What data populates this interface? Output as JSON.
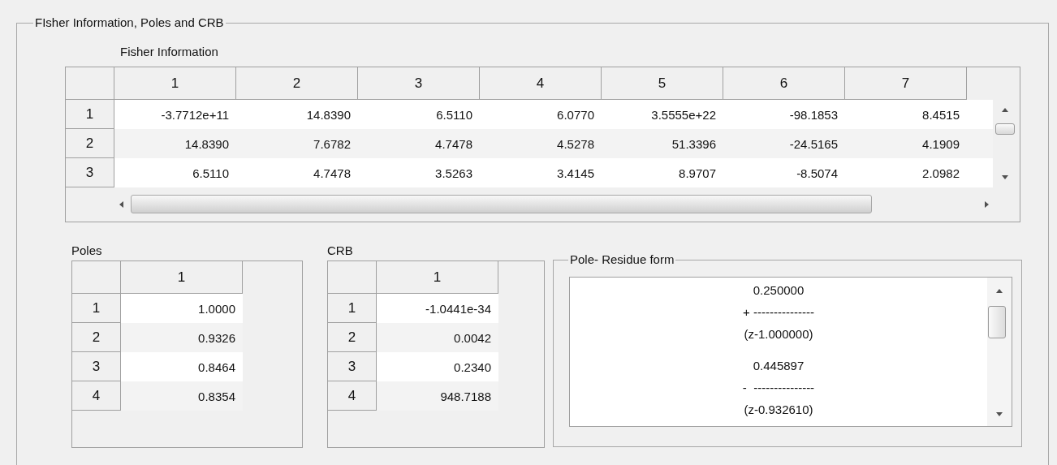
{
  "panel": {
    "title": "FIsher Information, Poles and  CRB"
  },
  "fisher": {
    "label": "Fisher Information",
    "columns": [
      "1",
      "2",
      "3",
      "4",
      "5",
      "6",
      "7"
    ],
    "rows": [
      {
        "header": "1",
        "cells": [
          "-3.7712e+11",
          "14.8390",
          "6.5110",
          "6.0770",
          "3.5555e+22",
          "-98.1853",
          "8.4515"
        ]
      },
      {
        "header": "2",
        "cells": [
          "14.8390",
          "7.6782",
          "4.7478",
          "4.5278",
          "51.3396",
          "-24.5165",
          "4.1909"
        ]
      },
      {
        "header": "3",
        "cells": [
          "6.5110",
          "4.7478",
          "3.5263",
          "3.4145",
          "8.9707",
          "-8.5074",
          "2.0982"
        ]
      }
    ]
  },
  "poles": {
    "label": "Poles",
    "columns": [
      "1"
    ],
    "rows": [
      {
        "header": "1",
        "cells": [
          "1.0000"
        ]
      },
      {
        "header": "2",
        "cells": [
          "0.9326"
        ]
      },
      {
        "header": "3",
        "cells": [
          "0.8464"
        ]
      },
      {
        "header": "4",
        "cells": [
          "0.8354"
        ]
      }
    ]
  },
  "crb": {
    "label": "CRB",
    "columns": [
      "1"
    ],
    "rows": [
      {
        "header": "1",
        "cells": [
          "-1.0441e-34"
        ]
      },
      {
        "header": "2",
        "cells": [
          "0.0042"
        ]
      },
      {
        "header": "3",
        "cells": [
          "0.2340"
        ]
      },
      {
        "header": "4",
        "cells": [
          "948.7188"
        ]
      }
    ]
  },
  "pole_residue": {
    "title": "Pole- Residue form",
    "terms": [
      {
        "numerator": "0.250000",
        "divider": "+ ---------------",
        "denominator": "(z-1.000000)"
      },
      {
        "numerator": "0.445897",
        "divider": "-  ---------------",
        "denominator": "(z-0.932610)"
      }
    ]
  }
}
